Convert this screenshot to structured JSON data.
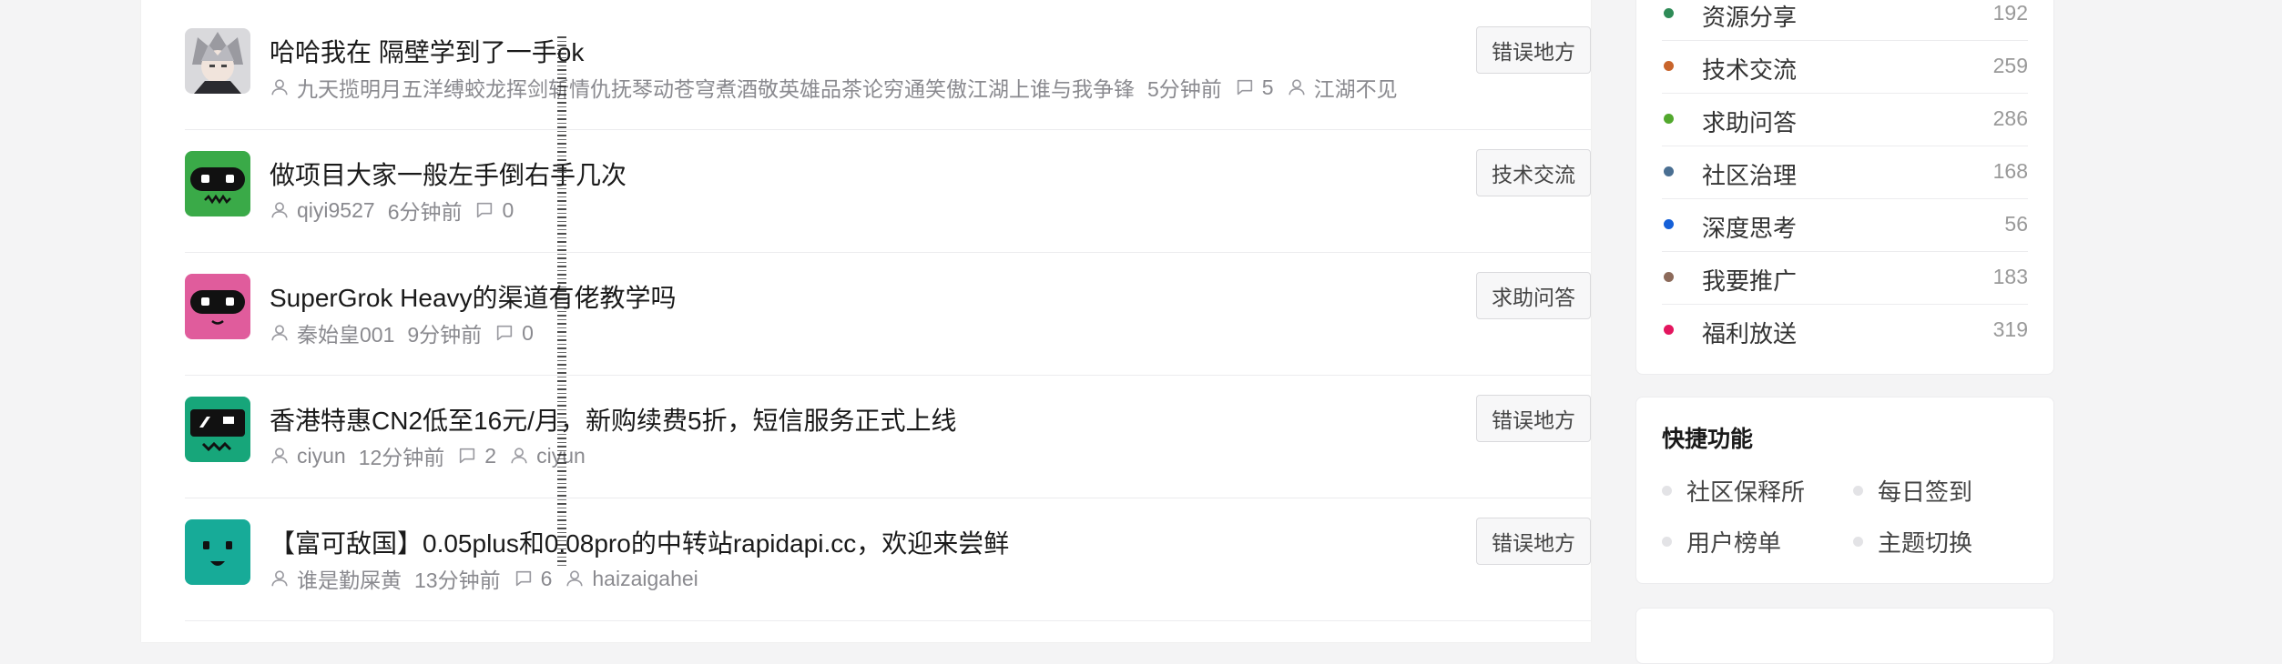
{
  "topics": [
    {
      "title": "哈哈我在 隔壁学到了一手ok",
      "author": "九天揽明月五洋缚蛟龙挥剑斩情仇抚琴动苍穹煮酒敬英雄品茶论穷通笑傲江湖上谁与我争锋",
      "time": "5分钟前",
      "replies": "5",
      "last_reply": "江湖不见",
      "tag": "错误地方",
      "avatar_icon": "anime-avatar-icon"
    },
    {
      "title": "做项目大家一般左手倒右手几次",
      "author": "qiyi9527",
      "time": "6分钟前",
      "replies": "0",
      "last_reply": "",
      "tag": "技术交流",
      "avatar_icon": "robot-avatar-icon"
    },
    {
      "title": "SuperGrok Heavy的渠道有佬教学吗",
      "author": "秦始皇001",
      "time": "9分钟前",
      "replies": "0",
      "last_reply": "",
      "tag": "求助问答",
      "avatar_icon": "robot-avatar-icon"
    },
    {
      "title": "香港特惠CN2低至16元/月，新购续费5折，短信服务正式上线",
      "author": "ciyun",
      "time": "12分钟前",
      "replies": "2",
      "last_reply": "ciyun",
      "tag": "错误地方",
      "avatar_icon": "robot-avatar-icon"
    },
    {
      "title": "【富可敌国】0.05plus和0.08pro的中转站rapidapi.cc，欢迎来尝鲜",
      "author": "谁是勤屎黄",
      "time": "13分钟前",
      "replies": "6",
      "last_reply": "haizaigahei",
      "tag": "错误地方",
      "avatar_icon": "robot-avatar-icon"
    }
  ],
  "categories": [
    {
      "name": "资源分享",
      "count": "192",
      "color": "#2e8b57"
    },
    {
      "name": "技术交流",
      "count": "259",
      "color": "#c8642b"
    },
    {
      "name": "求助问答",
      "count": "286",
      "color": "#52a82d"
    },
    {
      "name": "社区治理",
      "count": "168",
      "color": "#4a6f92"
    },
    {
      "name": "深度思考",
      "count": "56",
      "color": "#1560d8"
    },
    {
      "name": "我要推广",
      "count": "183",
      "color": "#8c6a5a"
    },
    {
      "name": "福利放送",
      "count": "319",
      "color": "#e3155e"
    }
  ],
  "quick": {
    "title": "快捷功能",
    "items": [
      "社区保释所",
      "每日签到",
      "用户榜单",
      "主题切换"
    ]
  },
  "colors": {
    "avatar_backgrounds": [
      "#7d7d82",
      "#3aaa48",
      "#e05c9c",
      "#17a67a",
      "#17ab98"
    ]
  }
}
